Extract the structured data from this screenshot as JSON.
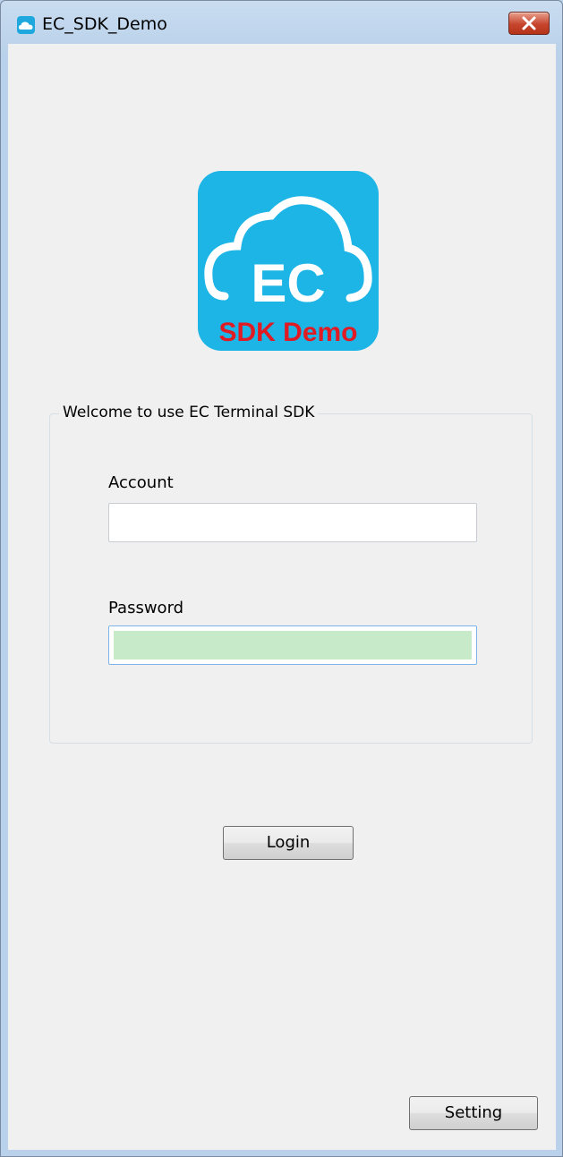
{
  "window": {
    "title": "EC_SDK_Demo"
  },
  "logo": {
    "big_text": "EC",
    "sub_text": "SDK Demo"
  },
  "login_group": {
    "legend": "Welcome to use EC Terminal SDK",
    "account_label": "Account",
    "account_value": "",
    "password_label": "Password",
    "password_value": ""
  },
  "buttons": {
    "login": "Login",
    "setting": "Setting"
  },
  "colors": {
    "logo_blue": "#1db4e6",
    "logo_red": "#e01b24",
    "password_fill": "#c7ebc9"
  }
}
